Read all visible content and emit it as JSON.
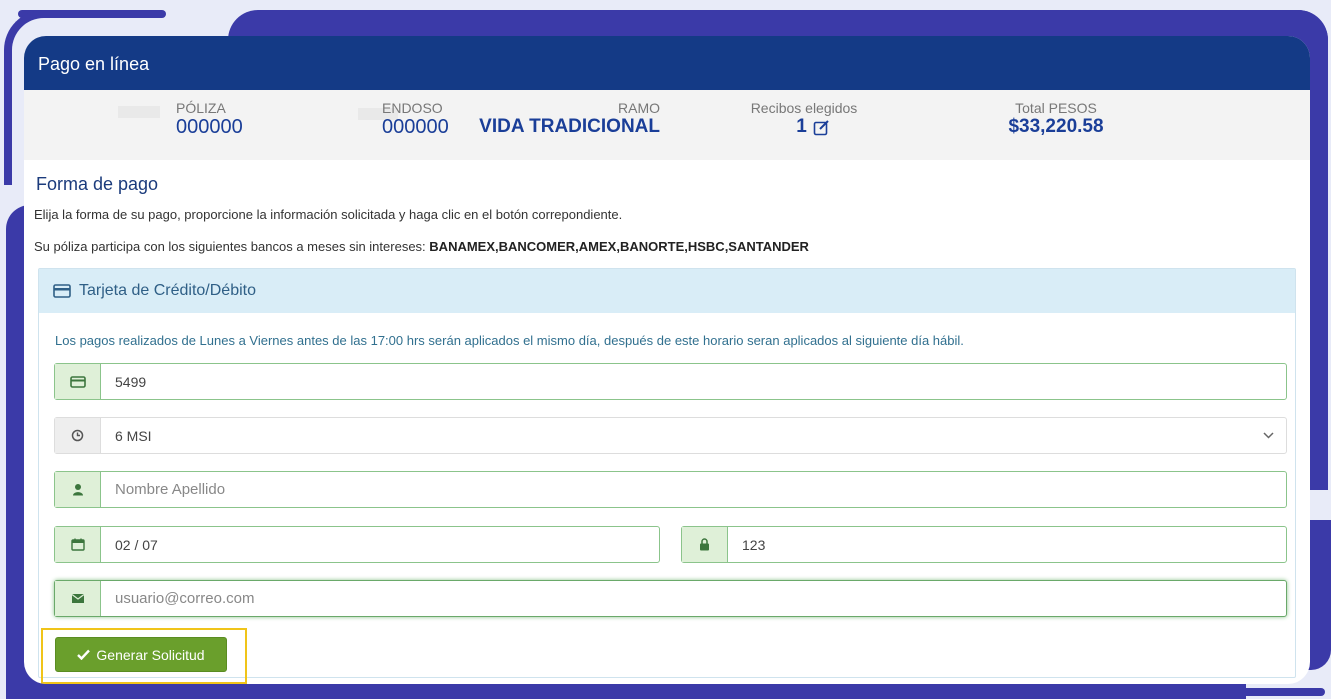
{
  "header": {
    "title": "Pago en línea"
  },
  "summary": {
    "poliza_label": "PÓLIZA",
    "poliza_value": "000000",
    "endoso_label": "ENDOSO",
    "endoso_value": "000000",
    "ramo_label": "RAMO",
    "ramo_value": "VIDA TRADICIONAL",
    "recibos_label": "Recibos elegidos",
    "recibos_value": "1",
    "total_label": "Total PESOS",
    "total_value": "$33,220.58"
  },
  "payment": {
    "section_title": "Forma de pago",
    "instructions": "Elija la forma de su pago, proporcione la información solicitada y haga clic en el botón correpondiente.",
    "banks_prefix": "Su póliza participa con los siguientes bancos a meses sin intereses:",
    "banks_list": "BANAMEX,BANCOMER,AMEX,BANORTE,HSBC,SANTANDER"
  },
  "card_panel": {
    "title": "Tarjeta de Crédito/Débito",
    "notice": "Los pagos realizados de Lunes a Viernes antes de las 17:00 hrs serán aplicados el mismo día, después de este horario seran aplicados al siguiente día hábil.",
    "card_number": "5499",
    "installments": "6 MSI",
    "name_placeholder": "Nombre Apellido",
    "expiry": "02 / 07",
    "cvv": "123",
    "email": "usuario@correo.com",
    "submit_label": "Generar Solicitud"
  },
  "colors": {
    "header_bg": "#143a86",
    "frame": "#3b3aa8",
    "success_btn": "#6a9f2c",
    "highlight": "#f0c419"
  }
}
